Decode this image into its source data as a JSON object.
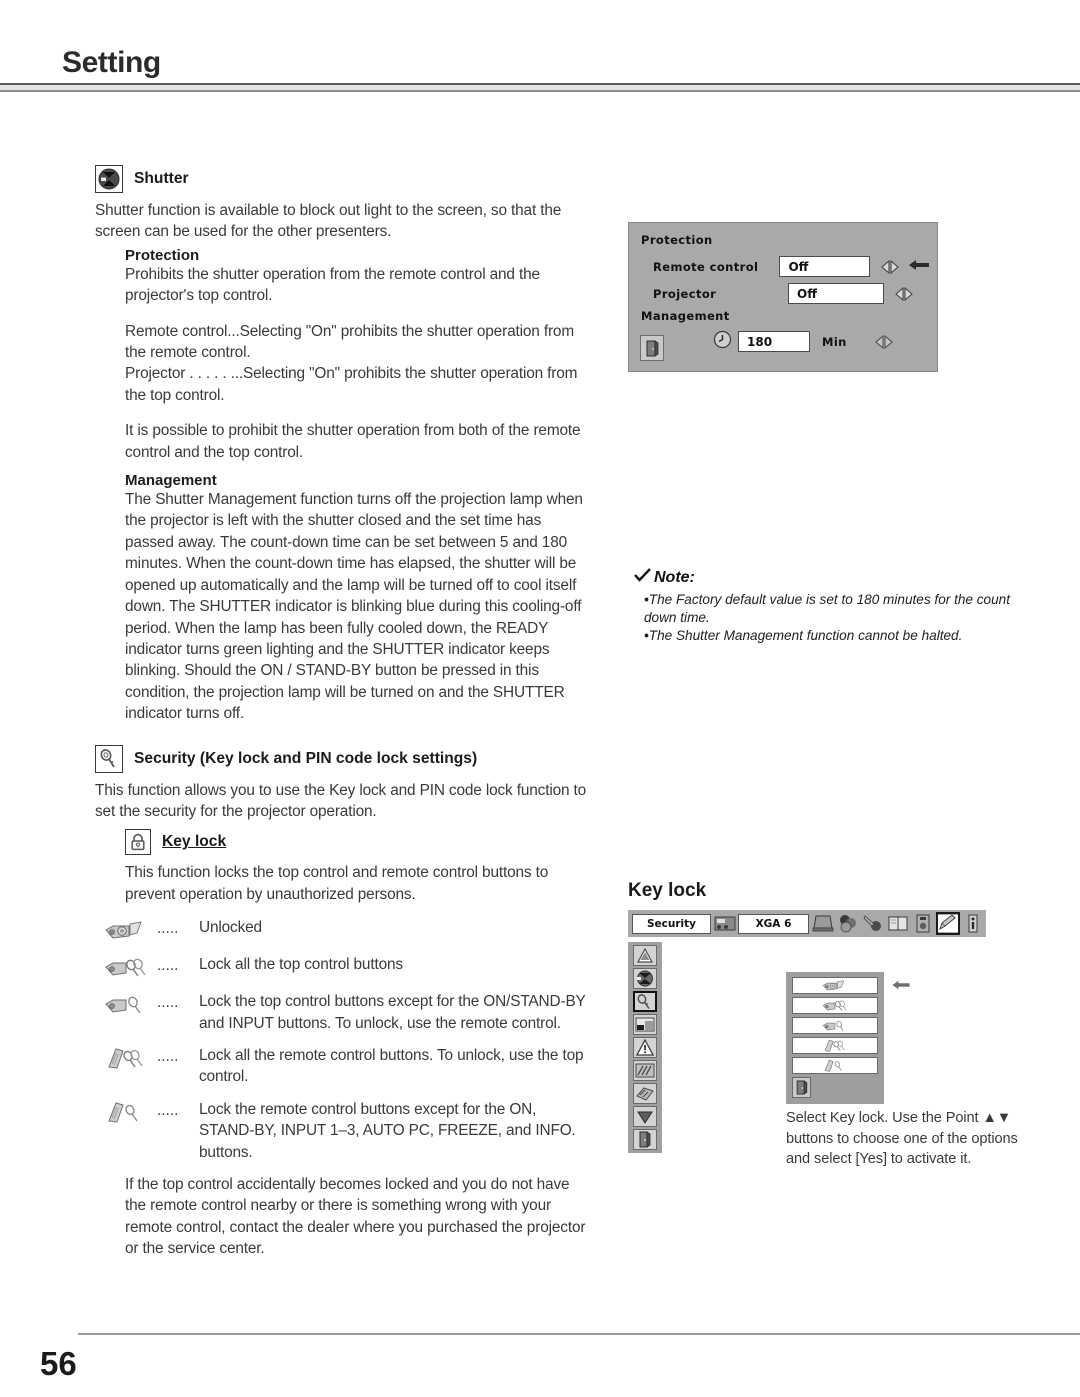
{
  "header": {
    "title": "Setting"
  },
  "footer": {
    "page_number": "56"
  },
  "shutter": {
    "icon": "shutter-icon",
    "heading": "Shutter",
    "intro": "Shutter function is available to block out light to the screen, so that the screen can be used for the other presenters.",
    "protection": {
      "label": "Protection",
      "desc": "Prohibits the shutter operation from the remote control and the projector's top control.",
      "items": [
        {
          "term": "Remote control...",
          "desc": "Selecting \"On\" prohibits the shutter operation from the remote control."
        },
        {
          "term": "Projector . . . . . ...",
          "desc": "Selecting \"On\" prohibits the shutter operation from the top control."
        }
      ],
      "note": "It is possible to prohibit the shutter operation from both of the remote control and the top control."
    },
    "management": {
      "label": "Management",
      "desc": "The Shutter Management function turns off the projection lamp when the projector is left with the shutter closed and the set time has passed away. The count-down time can be set between 5 and 180 minutes.  When the count-down time has elapsed, the shutter will be opened up automatically and the lamp will be turned off to cool itself down. The SHUTTER indicator is blinking blue during this cooling-off period. When the lamp has been fully cooled down, the READY indicator turns green lighting and the SHUTTER indicator keeps blinking. Should the ON / STAND-BY button be pressed in this condition, the projection lamp will be turned on and the SHUTTER indicator turns off."
    }
  },
  "osd_protection": {
    "title": "Protection",
    "rows": [
      {
        "label": "Remote control",
        "value": "Off",
        "pointer": true
      },
      {
        "label": "Projector",
        "value": "Off",
        "pointer": false
      }
    ],
    "management_title": "Management",
    "timer_value": "180",
    "timer_unit": "Min",
    "exit_icon": "exit-door-icon",
    "clock_icon": "clock-icon",
    "bg_color": "#a9a9a9"
  },
  "note": {
    "check_icon": "check-icon",
    "title": "Note:",
    "items": [
      "The Factory default value is set to 180 minutes for the count down time.",
      "The Shutter Management function cannot be halted."
    ]
  },
  "security": {
    "icon": "key-icon",
    "heading": "Security (Key lock and PIN code lock settings)",
    "desc": "This function allows you to use the Key lock and PIN code lock function to set the security for the projector operation.",
    "key_lock": {
      "icon": "padlock-icon",
      "heading": "Key lock",
      "desc": "This function locks the top control and remote control buttons to prevent operation by unauthorized persons.",
      "dots": ".....",
      "options": [
        {
          "icon": "projector-unlocked-icon",
          "text": "Unlocked"
        },
        {
          "icon": "projector-lock-all-icon",
          "text": "Lock all the top control buttons"
        },
        {
          "icon": "projector-lock-partial-icon",
          "text": "Lock the top control buttons except for the ON/STAND-BY and INPUT buttons. To unlock, use the remote control."
        },
        {
          "icon": "remote-lock-all-icon",
          "text": "Lock all the remote control buttons. To unlock, use the top control."
        },
        {
          "icon": "remote-lock-partial-icon",
          "text": "Lock the remote control buttons except for the ON, STAND-BY, INPUT 1–3, AUTO PC, FREEZE, and INFO. buttons."
        }
      ],
      "closing": "If the top control accidentally becomes locked and you do not have the remote control nearby or there is something wrong with your remote control, contact the dealer where you purchased the projector or the service center."
    }
  },
  "key_lock_osd": {
    "title": "Key lock",
    "menu_label": "Security",
    "input_label": "XGA 6",
    "menubar_icons": [
      "input-source-icon",
      "computer-icon",
      "color-adjust-icon",
      "image-adjust-icon",
      "screen-icon",
      "sound-icon",
      "setting-pencil-icon",
      "information-icon"
    ],
    "selected_menubar_icon": "setting-pencil-icon",
    "sidebar_icons": [
      "keystone-icon",
      "shutter-icon",
      "security-key-icon",
      "lamp-icon",
      "warning-icon",
      "filter-icon",
      "filter-counter-icon",
      "down-arrow-icon",
      "exit-door-icon"
    ],
    "selected_sidebar_icon": "security-key-icon",
    "dropdown_options": [
      "projector-unlocked-icon",
      "projector-lock-all-icon",
      "projector-lock-partial-icon",
      "remote-lock-all-icon",
      "remote-lock-partial-icon"
    ],
    "exit_icon": "exit-door-icon",
    "pointer_icon": "left-arrow-icon",
    "caption": "Select Key lock. Use the Point ▲▼ buttons to choose one of the options and select [Yes] to activate it."
  }
}
